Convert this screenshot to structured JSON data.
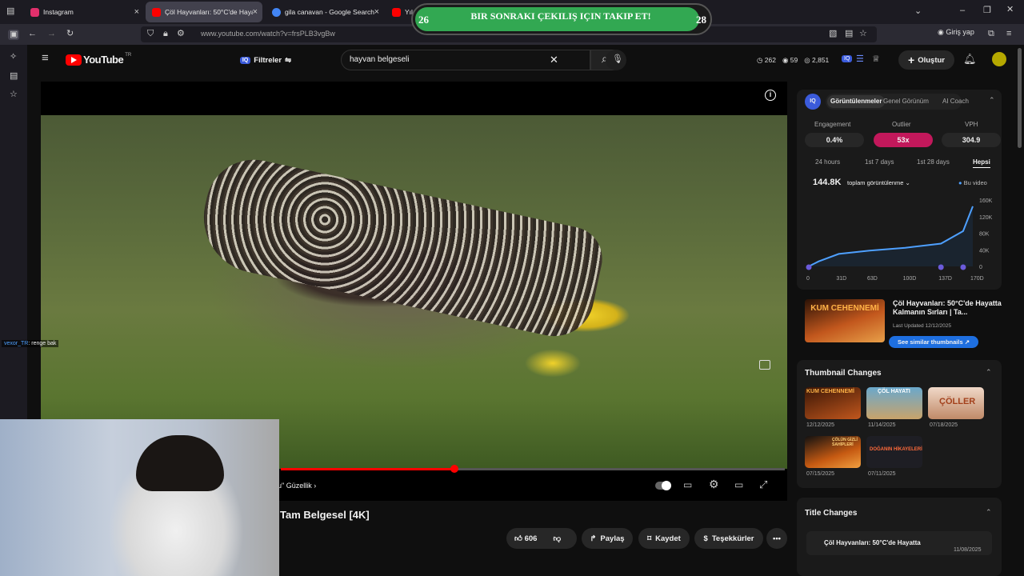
{
  "browser": {
    "tabs": [
      {
        "label": "Instagram",
        "color": "#e1306c"
      },
      {
        "label": "Çöl Hayvanları: 50°C'de Hayatta",
        "color": "#ff0000"
      },
      {
        "label": "gila canavan - Google Search",
        "color": "#4285f4"
      },
      {
        "label": "Yılar",
        "color": "#ff0000"
      }
    ],
    "url": "www.youtube.com/watch?v=frsPLB3vgBw",
    "signin_label": "Giriş yap"
  },
  "banner": {
    "left_num": "26",
    "text": "BIR SONRAKI ÇEKILIŞ IÇIN TAKIP ET!",
    "right_num": "28"
  },
  "youtube": {
    "logo": "YouTube",
    "region": "TR",
    "filters_label": "Filtreler",
    "search_value": "hayvan belgeseli",
    "stats": {
      "a": "262",
      "b": "59",
      "c": "2,851"
    },
    "create_label": "Oluştur"
  },
  "video": {
    "chapter": "u\" Güzellik",
    "title": "Tam Belgesel [4K]",
    "likes": "606",
    "share_label": "Paylaş",
    "save_label": "Kaydet",
    "thanks_label": "Teşekkürler"
  },
  "chat": {
    "user": "vexor_TR",
    "message": ": renge bak"
  },
  "panel": {
    "tabs": [
      "Görüntülenmeler",
      "Genel Görünüm",
      "AI Coach"
    ],
    "metrics": [
      {
        "label": "Engagement",
        "value": "0.4%"
      },
      {
        "label": "Outlier",
        "value": "53x",
        "color": "#c2185b"
      },
      {
        "label": "VPH",
        "value": "304.9"
      }
    ],
    "ranges": [
      "24 hours",
      "1st 7 days",
      "1st 28 days",
      "Hepsi"
    ],
    "views_total": "144.8K",
    "views_label": "toplam görüntülenme",
    "this_video_label": "Bu video",
    "chart_data": {
      "type": "line",
      "x_ticks": [
        "0",
        "31D",
        "63D",
        "100D",
        "137D",
        "170D"
      ],
      "y_ticks": [
        "160K",
        "120K",
        "80K",
        "40K",
        "0"
      ],
      "series": [
        {
          "x": [
            0,
            10,
            31,
            63,
            100,
            137,
            160,
            170
          ],
          "y": [
            0,
            12000,
            30000,
            38000,
            45000,
            55000,
            85000,
            144800
          ]
        }
      ]
    },
    "similar": {
      "thumb_text": "KUM CEHENNEMİ",
      "title": "Çöl Hayvanları: 50°C'de Hayatta Kalmanın Sırları | Ta...",
      "updated": "Last Updated 12/12/2025",
      "button": "See similar thumbnails"
    },
    "thumbnail_changes_title": "Thumbnail Changes",
    "thumbs": [
      {
        "text": "KUM CEHENNEMİ",
        "date": "12/12/2025",
        "color": "#b5531c"
      },
      {
        "text": "ÇÖL HAYATI",
        "date": "11/14/2025",
        "color": "#4d8fb3"
      },
      {
        "text": "ÇÖLLER",
        "date": "07/18/2025",
        "color": "#d8b8a0"
      },
      {
        "text": "ÇÖLÜN GİZLİ SAHİPLERİ",
        "date": "07/15/2025",
        "color": "#c65a12"
      },
      {
        "text": "DOĞANIN HİKAYELERİ",
        "date": "07/11/2025",
        "color": "#2a2a30"
      }
    ],
    "title_changes_title": "Title Changes",
    "title_change": {
      "text": "Çöl Hayvanları: 50°C'de Hayatta",
      "date": "11/08/2025"
    }
  }
}
